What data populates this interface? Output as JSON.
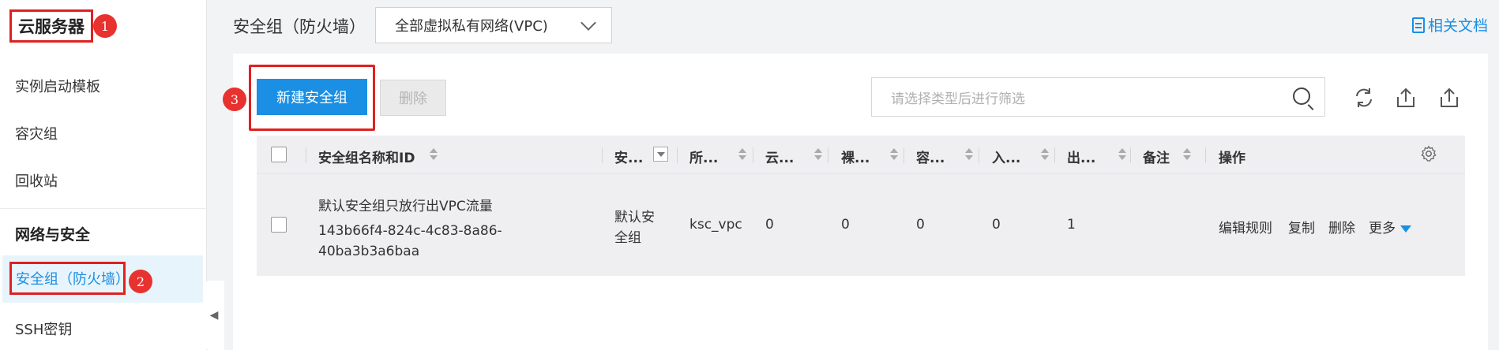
{
  "sidebar": {
    "brand": "云服务器",
    "items": [
      {
        "label": "实例启动模板"
      },
      {
        "label": "容灾组"
      },
      {
        "label": "回收站"
      }
    ],
    "section_title": "网络与安全",
    "active_item": "安全组（防火墙）",
    "next_item": "SSH密钥"
  },
  "badges": [
    "1",
    "2",
    "3"
  ],
  "header": {
    "title": "安全组（防火墙）",
    "vpc_select_value": "全部虚拟私有网络(VPC)",
    "docs_link": "相关文档"
  },
  "toolbar": {
    "new_button": "新建安全组",
    "delete_button": "删除",
    "search_placeholder": "请选择类型后进行筛选",
    "icons": [
      "refresh-icon",
      "export-icon",
      "upload-icon"
    ]
  },
  "table": {
    "columns": [
      "安全组名称和ID",
      "安...",
      "所...",
      "云...",
      "裸...",
      "容...",
      "入...",
      "出...",
      "备注",
      "操作"
    ],
    "rows": [
      {
        "name": "默认安全组只放行出VPC流量",
        "id_line1": "143b66f4-824c-4c83-8a86-",
        "id_line2": "40ba3b3a6baa",
        "type_line1": "默认安",
        "type_line2": "全组",
        "vpc": "ksc_vpc",
        "c1": "0",
        "c2": "0",
        "c3": "0",
        "c4": "0",
        "c5": "1",
        "remark": "",
        "actions": [
          "编辑规则",
          "复制",
          "删除",
          "更多"
        ]
      }
    ]
  },
  "colors": {
    "accent": "#1a8fe3",
    "highlight_red": "#e02020",
    "badge_red": "#e8322f"
  }
}
